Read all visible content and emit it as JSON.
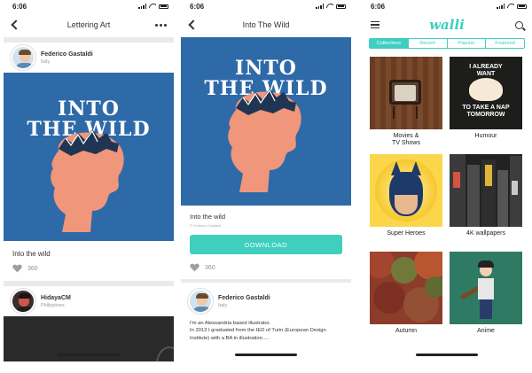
{
  "status": {
    "time": "6:06"
  },
  "screen1": {
    "title": "Lettering Art",
    "card1": {
      "author_name": "Federico Gastaldi",
      "author_location": "Italy",
      "poster_line1": "INTO",
      "poster_line2": "THE WILD",
      "art_title": "Into the wild",
      "likes": "360"
    },
    "card2": {
      "author_name": "HidayaCM",
      "author_location": "Philippines"
    }
  },
  "screen2": {
    "title": "Into The Wild",
    "poster_line1": "INTO",
    "poster_line2": "THE WILD",
    "art_title": "Into the wild",
    "credit": "© Federico Gastaldi",
    "download_label": "DOWNLOAD",
    "likes": "360",
    "author_name": "Federico Gastaldi",
    "author_location": "Italy",
    "bio_line1": "I'm an Alessandria based illustrator.",
    "bio_line2": "In 2013 I graduated from the IED of Turin (European Design",
    "bio_line3": "Institute) with a BA in illustration....."
  },
  "screen3": {
    "logo": "walli",
    "tabs": [
      "Collections",
      "Recent",
      "Popular",
      "Featured"
    ],
    "active_tab": "Collections",
    "categories": [
      {
        "label_line1": "Movies &",
        "label_line2": "TV Shows"
      },
      {
        "label_line1": "Humour",
        "label_line2": ""
      },
      {
        "label_line1": "Super Heroes",
        "label_line2": ""
      },
      {
        "label_line1": "4K wallpapers",
        "label_line2": ""
      },
      {
        "label_line1": "Autumn",
        "label_line2": ""
      },
      {
        "label_line1": "Anime",
        "label_line2": ""
      }
    ],
    "humour_art_text": [
      "I ALREADY",
      "WANT",
      "TO TAKE A NAP",
      "TOMORROW"
    ]
  },
  "colors": {
    "accent": "#3ecfbf",
    "poster_bg": "#2e6aa8",
    "head": "#f0967a"
  }
}
